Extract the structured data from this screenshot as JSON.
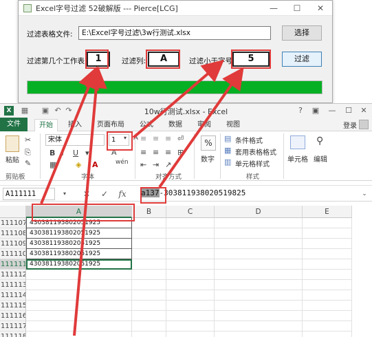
{
  "tool": {
    "title": "Excel字号过滤 52破解版 --- Pierce[LCG]",
    "file_label": "过滤表格文件:",
    "file_path": "E:\\Excel字号过滤\\3w行测试.xlsx",
    "browse_label": "选择",
    "sheet_label": "过滤第几个工作表:",
    "sheet_value": "1",
    "column_label": "过滤列:",
    "column_value": "A",
    "size_label": "过滤小于字号:",
    "size_value": "5",
    "filter_label": "过滤",
    "progress": 1.0,
    "progress_color": "#06b025"
  },
  "excel": {
    "title": "10w行测试.xlsx - Excel",
    "title_buttons": [
      "?",
      "▣",
      "—",
      "☐",
      "✕"
    ],
    "tabs": [
      "文件",
      "开始",
      "插入",
      "页面布局",
      "公式",
      "数据",
      "审阅",
      "视图"
    ],
    "active_tab": "开始",
    "sign_in": "登录",
    "ribbon": {
      "paste": "粘贴",
      "clipboard": "剪贴板",
      "font_name": "宋体",
      "font_size": "1",
      "font_group": "字体",
      "align_group": "对齐方式",
      "number_icon": "%",
      "number": "数字",
      "cond_format": "条件格式",
      "table_format": "套用表格格式",
      "cell_style": "单元格样式",
      "styles_group": "样式",
      "cells": "单元格",
      "editing": "编辑"
    },
    "name_box": "A111111",
    "formula_selected": "a137",
    "formula_rest": "-303811938020519825",
    "columns": [
      "A",
      "B",
      "C",
      "D",
      "E"
    ],
    "rows": [
      {
        "num": "111107",
        "value": "430381193802051925"
      },
      {
        "num": "111108",
        "value": "430381193802051925"
      },
      {
        "num": "111109",
        "value": "430381193802051925"
      },
      {
        "num": "111110",
        "value": "430381193802051925"
      },
      {
        "num": "111111",
        "value": "430381193802051925"
      },
      {
        "num": "111112",
        "value": ""
      },
      {
        "num": "111113",
        "value": ""
      },
      {
        "num": "111114",
        "value": ""
      },
      {
        "num": "111115",
        "value": ""
      },
      {
        "num": "111116",
        "value": ""
      },
      {
        "num": "111117",
        "value": ""
      },
      {
        "num": "111118",
        "value": ""
      }
    ],
    "accent": "#217346"
  },
  "annotation_color": "#e03a3a"
}
